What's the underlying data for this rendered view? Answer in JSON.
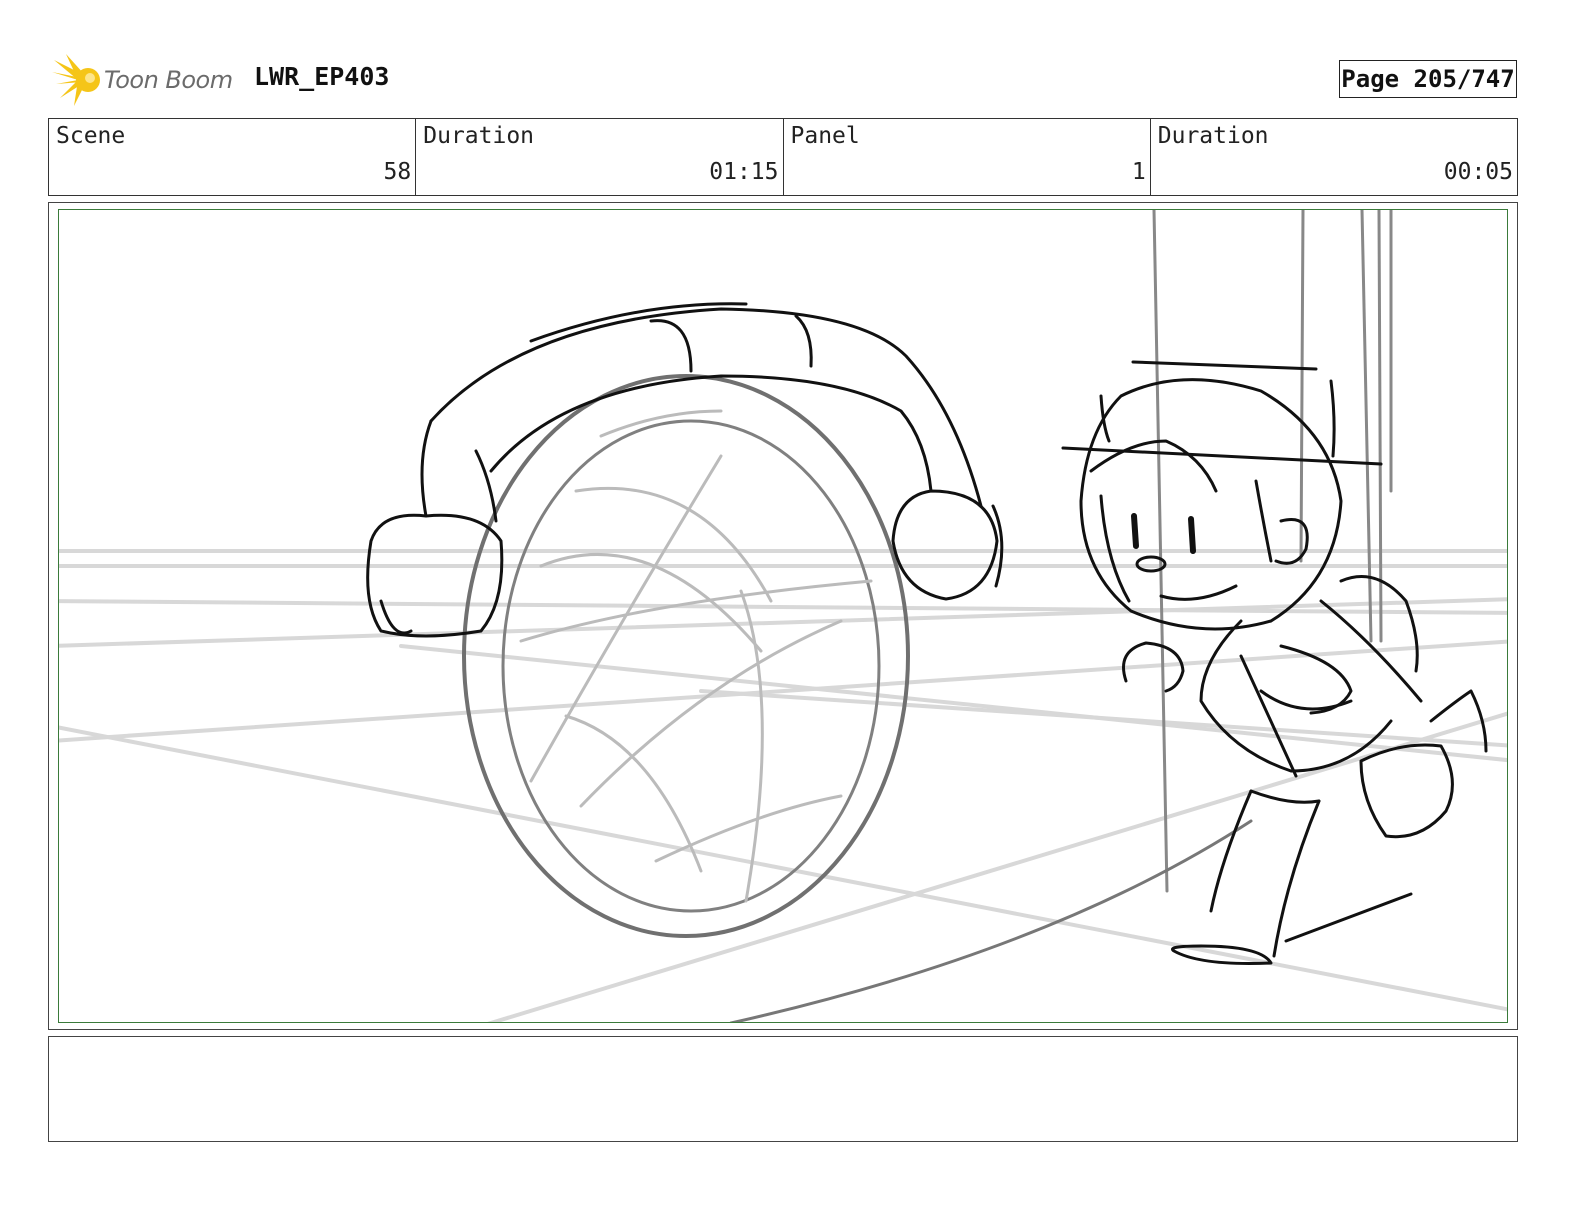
{
  "header": {
    "logo_text": "Toon Boom",
    "logo_color": "#f5c518",
    "project": "LWR_EP403",
    "page": "Page 205/747"
  },
  "info": {
    "scene_label": "Scene",
    "scene_value": "58",
    "scene_duration_label": "Duration",
    "scene_duration_value": "01:15",
    "panel_label": "Panel",
    "panel_value": "1",
    "panel_duration_label": "Duration",
    "panel_duration_value": "00:05"
  },
  "panel": {
    "frame_color": "#3a7a3a"
  },
  "notes": {
    "text": ""
  }
}
